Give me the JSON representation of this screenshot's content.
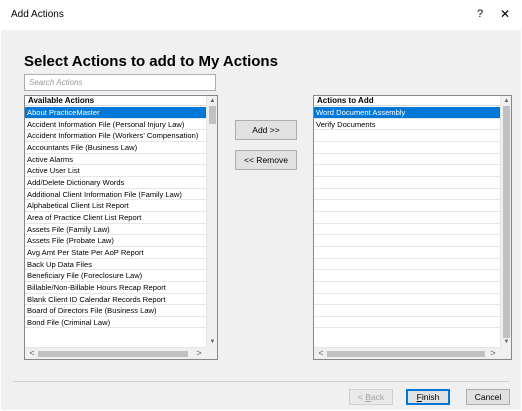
{
  "window": {
    "title": "Add Actions",
    "help_label": "?",
    "close_label": "✕"
  },
  "heading": "Select Actions to add to My Actions",
  "search": {
    "placeholder": "Search Actions",
    "value": ""
  },
  "available": {
    "header": "Available Actions",
    "selected_index": 0,
    "items": [
      "About PracticeMaster",
      "Accident Information File (Personal Injury Law)",
      "Accident Information File (Workers' Compensation)",
      "Accountants File (Business Law)",
      "Active Alarms",
      "Active User List",
      "Add/Delete Dictionary Words",
      "Additional Client Information File (Family Law)",
      "Alphabetical Client List Report",
      "Area of Practice Client List Report",
      "Assets File (Family Law)",
      "Assets File (Probate Law)",
      "Avg Amt Per State Per AoP Report",
      "Back Up Data Files",
      "Beneficiary File (Foreclosure Law)",
      "Billable/Non-Billable Hours Recap Report",
      "Blank Client ID Calendar Records Report",
      "Board of Directors File (Business Law)",
      "Bond File (Criminal Law)"
    ]
  },
  "to_add": {
    "header": "Actions to Add",
    "selected_index": 0,
    "items": [
      "Word Document Assembly",
      "Verify Documents",
      "",
      "",
      "",
      "",
      "",
      "",
      "",
      "",
      "",
      "",
      "",
      "",
      "",
      "",
      "",
      "",
      ""
    ]
  },
  "buttons": {
    "add": "Add >>",
    "remove": "<< Remove",
    "back_prefix": "< ",
    "back_underlined": "B",
    "back_rest": "ack",
    "finish_underlined": "F",
    "finish_rest": "inish",
    "cancel": "Cancel"
  },
  "icons": {
    "scroll_up": "▲",
    "scroll_down": "▼",
    "scroll_left": "<",
    "scroll_right": ">"
  },
  "colors": {
    "selection": "#0078d7",
    "dialog_background": "#f0f0f0"
  }
}
